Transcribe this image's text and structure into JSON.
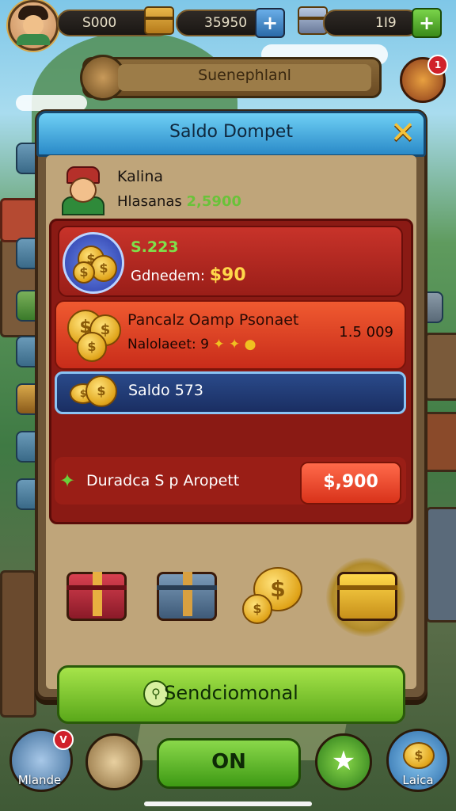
{
  "top": {
    "coins": "S000",
    "gems": "35950",
    "energy": "1Ι9",
    "banner_label": "Suenephlanl",
    "notif_count": "1"
  },
  "modal": {
    "title": "Saldo Dompet",
    "user": {
      "name": "Kalina",
      "balance_label": "Hlasanas",
      "balance_value": "2,5900"
    },
    "card_balance": {
      "value": "S.223",
      "label": "Gdnedem:",
      "amount": "$90"
    },
    "card_offer": {
      "title": "Pancalz Oamp Psonaet",
      "subtitle": "Nalolaeet: 9",
      "amount": "1.5 009"
    },
    "card_saldo": {
      "label": "Saldo 573"
    },
    "purchase": {
      "label": "Duradca S p Aropett",
      "price": "$,900"
    },
    "items": [
      {
        "name": "red-chest",
        "color": "#b8283a"
      },
      {
        "name": "blue-chest",
        "color": "#5a7a98"
      },
      {
        "name": "gold-coins",
        "color": "#e8b020"
      },
      {
        "name": "gold-chest",
        "color": "#f0c030"
      }
    ],
    "send_button": "Sendciomonal"
  },
  "bottom": {
    "left_label": "Mlande",
    "left_badge": "V",
    "center_button": "ON",
    "right_label": "Laica"
  }
}
